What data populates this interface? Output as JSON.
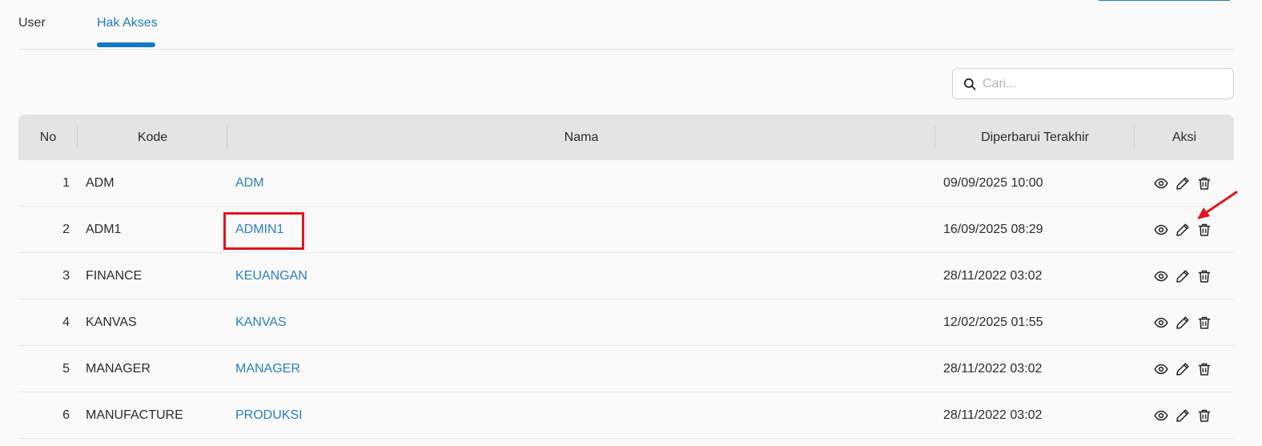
{
  "tabs": [
    {
      "label": "User",
      "active": false
    },
    {
      "label": "Hak Akses",
      "active": true
    }
  ],
  "search": {
    "placeholder": "Cari...",
    "value": ""
  },
  "table": {
    "headers": {
      "no": "No",
      "kode": "Kode",
      "nama": "Nama",
      "updated": "Diperbarui Terakhir",
      "aksi": "Aksi"
    },
    "rows": [
      {
        "no": "1",
        "kode": "ADM",
        "nama": "ADM",
        "updated": "09/09/2025 10:00"
      },
      {
        "no": "2",
        "kode": "ADM1",
        "nama": "ADMIN1",
        "updated": "16/09/2025 08:29"
      },
      {
        "no": "3",
        "kode": "FINANCE",
        "nama": "KEUANGAN",
        "updated": "28/11/2022 03:02"
      },
      {
        "no": "4",
        "kode": "KANVAS",
        "nama": "KANVAS",
        "updated": "12/02/2025 01:55"
      },
      {
        "no": "5",
        "kode": "MANAGER",
        "nama": "MANAGER",
        "updated": "28/11/2022 03:02"
      },
      {
        "no": "6",
        "kode": "MANUFACTURE",
        "nama": "PRODUKSI",
        "updated": "28/11/2022 03:02"
      }
    ],
    "row_actions": [
      "eye-icon",
      "pencil-icon",
      "trash-icon"
    ]
  },
  "annotations": {
    "highlight_color": "#e3141c",
    "arrow_color": "#e3141c"
  },
  "colors": {
    "accent": "#1579c6",
    "link": "#2a7fba",
    "header_bg": "#e4e4e4"
  }
}
